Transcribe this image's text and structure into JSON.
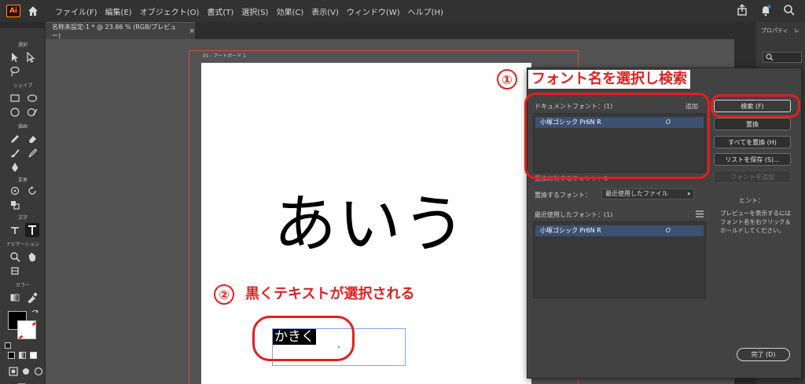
{
  "menubar": {
    "logo": "Ai",
    "items": [
      "ファイル(F)",
      "編集(E)",
      "オブジェクト(O)",
      "書式(T)",
      "選択(S)",
      "効果(C)",
      "表示(V)",
      "ウィンドウ(W)",
      "ヘルプ(H)"
    ],
    "icons": [
      "share-icon",
      "notification-icon",
      "search-icon"
    ]
  },
  "document": {
    "tab_title": "名称未設定-1 * @ 23.86 % (RGB/プレビュー)",
    "tab_close": "×",
    "artboard_label": "01 - アートボード 1"
  },
  "toolbar": {
    "sections": [
      "選択",
      "シェイプ",
      "描画",
      "変更",
      "文字",
      "ナビゲーション",
      "カラー"
    ]
  },
  "canvas": {
    "big_text": "あいう",
    "selected_text": "かきく"
  },
  "annotations": {
    "step1_number": "①",
    "step1_text": "フォント名を選択し検索",
    "step2_number": "②",
    "step2_text": "黒くテキストが選択される",
    "color": "#e02020"
  },
  "find_font_dialog": {
    "document_fonts_label": "ドキュメントフォント：(1)",
    "add_label": "追加",
    "document_fonts": [
      {
        "name": "小塚ゴシック Pr6N R",
        "type_icon": "O"
      }
    ],
    "replace_in_document_label": "置換に対するフォント：0",
    "replace_with_label": "置換するフォント：",
    "replace_with_value": "最近使用したファイル",
    "recent_fonts_label": "最近使用したフォント：(1)",
    "recent_fonts": [
      {
        "name": "小塚ゴシック Pr6N R",
        "type_icon": "O"
      }
    ],
    "buttons": {
      "find": "検索 (F)",
      "change": "置換",
      "change_all": "すべてを置換 (H)",
      "save_list": "リストを保存 (S)...",
      "add_font": "フォントを追加"
    },
    "hint_title": "ヒント：",
    "hint_text": "プレビューを表示するにはフォント名を右クリック＆ホールドしてください。",
    "done": "完了 (D)"
  },
  "right_panel": {
    "tabs": [
      "プロパティ",
      "レ"
    ]
  },
  "colors": {
    "accent_red": "#e02020",
    "selection_blue": "#3c5170",
    "panel_bg": "#424242"
  }
}
